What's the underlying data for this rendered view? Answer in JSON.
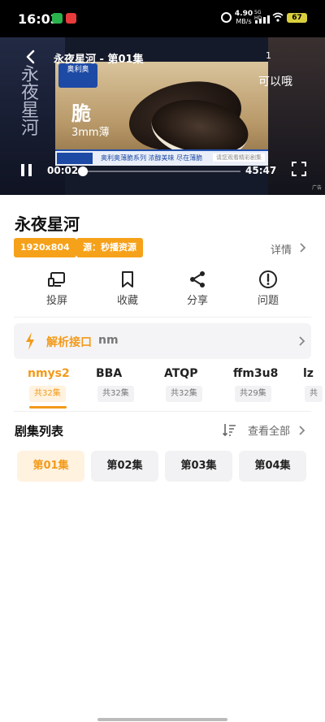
{
  "status_bar": {
    "time": "16:03",
    "net_speed_value": "4.90",
    "net_speed_unit": "MB/s",
    "network_type": "5G HD",
    "battery": "67"
  },
  "player": {
    "title": "永夜星河 - 第01集",
    "poster_text": "永夜星河",
    "ad_countdown": "1",
    "ad_slogan": "可以哦",
    "ad_brand": "奥利奥",
    "ad_headline": "脆",
    "ad_subline": "3mm薄",
    "ad_banner": "奥利奥薄脆系列 浓醇美味 尽在薄脆",
    "ad_cta": "请您观看精彩剧集",
    "ad_tag": "广告",
    "current_time": "00:02",
    "total_time": "45:47",
    "progress": 0.0007
  },
  "show": {
    "title": "永夜星河",
    "tag_resolution": "1920x804",
    "tag_source": "源：秒播资源",
    "details_label": "详情"
  },
  "actions": [
    {
      "label": "投屏",
      "icon": "cast-icon"
    },
    {
      "label": "收藏",
      "icon": "bookmark-icon"
    },
    {
      "label": "分享",
      "icon": "share-icon"
    },
    {
      "label": "问题",
      "icon": "alert-icon"
    }
  ],
  "parse_interface": {
    "label": "解析接口",
    "value": "nm"
  },
  "sources": [
    {
      "name": "nmys2",
      "count": "共32集",
      "active": true
    },
    {
      "name": "BBA",
      "count": "共32集",
      "active": false
    },
    {
      "name": "ATQP",
      "count": "共32集",
      "active": false
    },
    {
      "name": "ffm3u8",
      "count": "共29集",
      "active": false
    },
    {
      "name": "lz",
      "count": "共",
      "active": false
    }
  ],
  "episodes": {
    "header": "剧集列表",
    "view_all_label": "查看全部",
    "items": [
      {
        "label": "第01集",
        "active": true
      },
      {
        "label": "第02集",
        "active": false
      },
      {
        "label": "第03集",
        "active": false
      },
      {
        "label": "第04集",
        "active": false
      }
    ]
  },
  "colors": {
    "accent": "#f39a1a",
    "tag_bg": "#f6a11a",
    "status_bar_bg": "#000000",
    "battery": "#d9cf3e"
  }
}
